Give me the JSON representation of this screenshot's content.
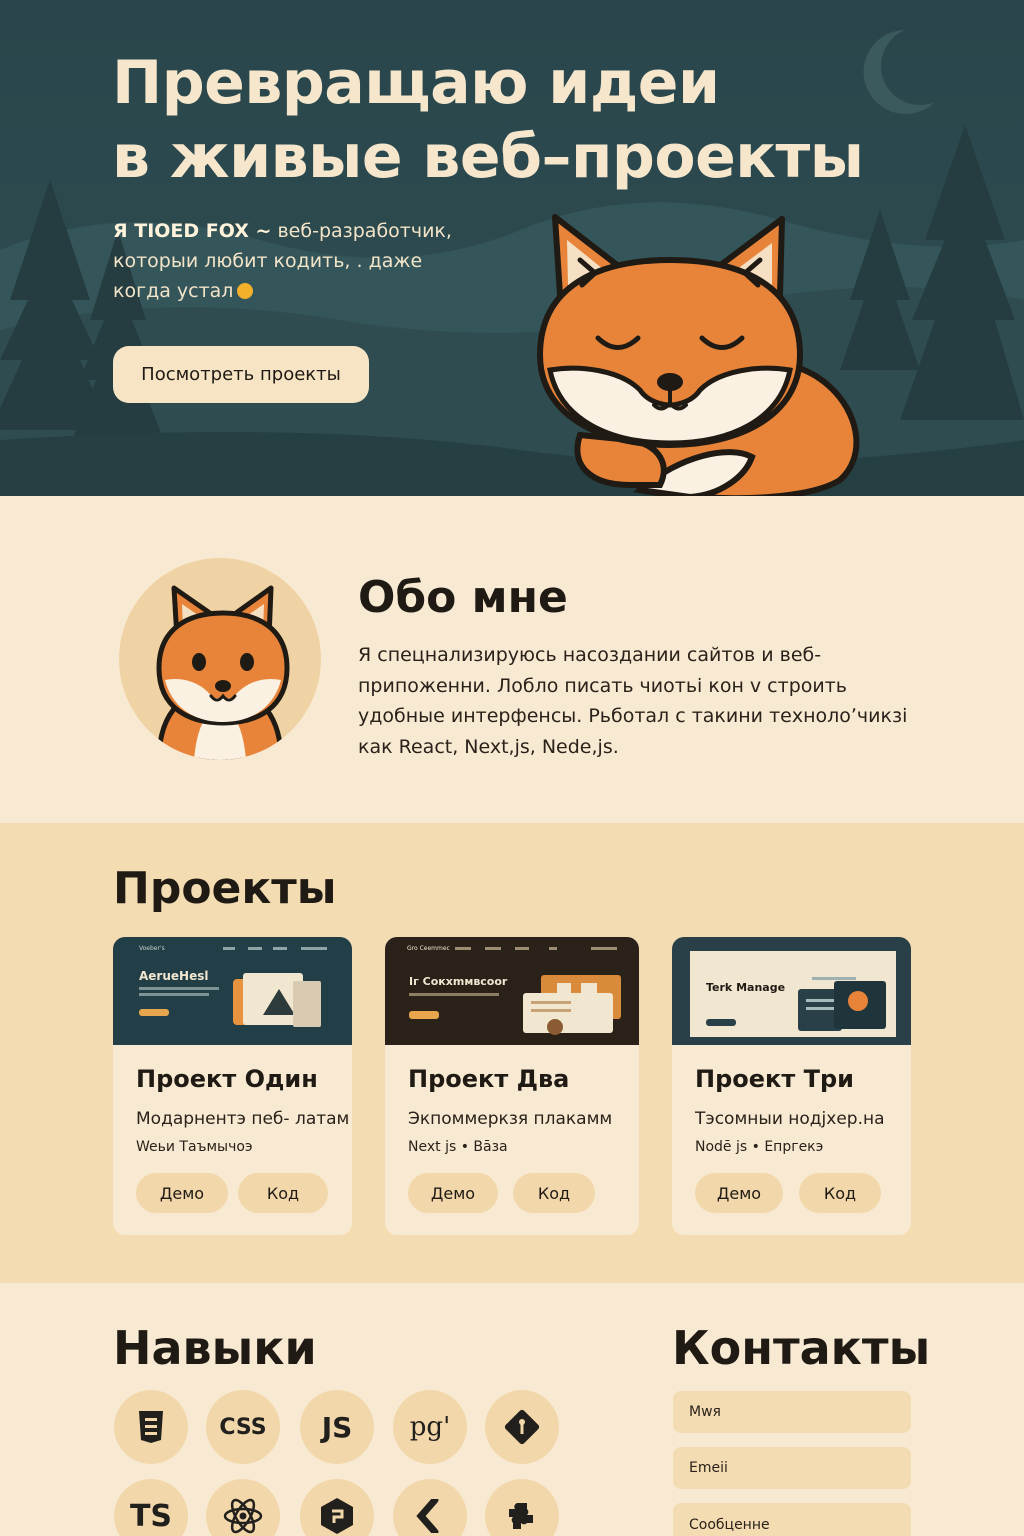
{
  "hero": {
    "title_line1": "Превращаю идеи",
    "title_line2": "в живые веб–проекты",
    "subtitle_name": "Я TIOED FOX ~",
    "subtitle_rest1": " веб-разработчик,",
    "subtitle_line2": "которыи любит кодить, . даже",
    "subtitle_line3": "когда устал",
    "cta_label": "Посмотреть проекты"
  },
  "about": {
    "title": "Обо мне",
    "line1": "Я спецнализируюсь насоздании сайтов и веб-",
    "line2": "припоженни. Лобло писать чиотьі кон v строить",
    "line3": "удобные интерфенсы. Рьботал с такини технолоʼчикзі",
    "line4": "как React, Next,js, Nede,js."
  },
  "projects": {
    "title": "Проекты",
    "items": [
      {
        "thumb_nav": "Voeber's",
        "thumb_heading": "AerueHesl",
        "title": "Проект Один",
        "description": "Модарнентэ пеб- латам",
        "tags": "Weьи Таъмычоэ",
        "demo_label": "Демо",
        "code_label": "Код"
      },
      {
        "thumb_nav": "Gro Ceemmec",
        "thumb_heading": "Iг Cокхmмвcoor",
        "title": "Проект Два",
        "description": "Экпоммеркзя плакамм",
        "tags": "Next js • Bāза",
        "demo_label": "Демо",
        "code_label": "Код"
      },
      {
        "thumb_nav": "",
        "thumb_heading": "Terk Manage",
        "title": "Проект Три",
        "description": "Тэсомныи нодjхер.на",
        "tags": "Nodē js • Епргекэ",
        "demo_label": "Демо",
        "code_label": "Код"
      }
    ]
  },
  "skills": {
    "title": "Навыки",
    "icons": [
      "html5-icon",
      "css-icon",
      "js-icon",
      "postgres-icon",
      "git-icon",
      "typescript-icon",
      "react-icon",
      "node-icon",
      "figma-icon",
      "puzzle-icon"
    ],
    "css_label": "CSS",
    "js_label": "JS",
    "pg_label": "pg'",
    "ts_label": "TS"
  },
  "contacts": {
    "title": "Контакты",
    "name_placeholder": "Mwя",
    "email_placeholder": "Emeii",
    "message_placeholder": "Сообценне"
  },
  "colors": {
    "hero_bg": "#2c4a4f",
    "cream": "#f8ead2",
    "sand": "#f4dcb2",
    "fox_orange": "#e8843a",
    "accent_yellow": "#f3b12b"
  }
}
